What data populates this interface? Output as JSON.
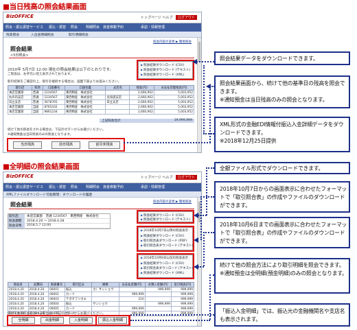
{
  "section1": {
    "title": "■当日残高の照会結果画面",
    "app": {
      "logo": "BizOFFICE",
      "toplinks": "トップページ  ヘルプ",
      "logout": "ログアウト",
      "nav": [
        "照会・振込振替サービス",
        "振込・振替",
        "照会",
        "明細照会",
        "資金移動予約",
        "承認・情報管理"
      ],
      "subnav": [
        "残高照会",
        "入出金明細照会",
        "取引明細照会"
      ],
      "page_title": "照会結果",
      "page_sub": "<5日照会>",
      "top_right_link": "照会内容の変更  ▶  簡易照会",
      "datetime": "2010年 5月7日 12:00 現在の照会結果は以下のとおりです。",
      "datetime_note": "ご照会は、お手元に控え表示されております。",
      "downloads": [
        "照会結果ダウンロード (CSV)",
        "照会結果ダウンロード (テキスト)",
        "照会結果ダウンロード (XML)"
      ],
      "table_caption": "取引結果をご確認の上、取引を継続する場合は、画面下部よりお進みください。",
      "table": {
        "headers": [
          "取引店",
          "科目",
          "口座番号",
          "口座名義",
          "支店名",
          "残高(円)",
          "お支払可能残高(円)"
        ],
        "rows": [
          [
            "本店営業部",
            "普通",
            "1234567",
            "東西物産　株式会社",
            "",
            "2,660,902",
            "5,003,952"
          ],
          [
            "丸の内支店",
            "普通",
            "1234567",
            "東西物産　株式会社",
            "北海道支店",
            "2,660,902",
            "5,003,952"
          ],
          [
            "日立支店",
            "普通",
            "5678765",
            "東西物産　株式会社",
            "日立支店",
            "2,660,902",
            "5,003,952"
          ],
          [
            "本店営業部",
            "当座",
            "8765432",
            "東西物産　株式会社",
            "",
            "2,660,902",
            "5,003,952"
          ],
          [
            "本店営業部",
            "当座",
            "9861234",
            "東西物産　株式会社",
            "",
            "2,660,902",
            "5,003,952"
          ]
        ]
      },
      "total_label": "上記照会合計",
      "total_value": "19,999,999",
      "footer_text": "続けて他の照会をされる場合は、下記のボタンからお選びください。",
      "footer_note": "※通知預金は当日残高のみの照会となります。",
      "buttons": [
        "当日残高",
        "前日残高",
        "前月末残高"
      ]
    },
    "notes": [
      "照会結果データをダウンロードできます。",
      "照会結果画面から、続けて他の基準日の残高を照会できます。\n※通知預金は当日残高のみの照会となります。",
      "XML形式の金融EDI情報付振込入金詳細データをダウンロードできます。\n※2018年12月25日提供"
    ]
  },
  "section2": {
    "title": "■全明細の照会結果画面",
    "app": {
      "logo": "BizOFFICE",
      "toplinks": "トップページ  ヘルプ",
      "logout": "ログアウト",
      "nav": [
        "照会・振込振替サービス",
        "振込・振替",
        "照会",
        "明細照会",
        "資金移動予約",
        "承認・情報管理"
      ],
      "breadcrumb": "XMLファイルダウンロード可能期間：ダウンロードの履歴",
      "page_title": "照会結果",
      "top_right_link": "照会内容の変更  ▶  簡易照会",
      "info": [
        [
          "取引店",
          "本店営業部　普通 1234567　東西物産　株式会社"
        ],
        [
          "照会期間",
          "2018.4.20 〜 2018.4.28"
        ],
        [
          "照会日時",
          "2018.5.7 12:00"
        ]
      ],
      "downloads_group1": [
        "照会結果ダウンロード (CSV)",
        "照会結果ダウンロード (テキスト)"
      ],
      "downloads_group1_head": "2018年10月7日以降の照会表示",
      "downloads_group2_head": "2018年10月6日以前の照会表示",
      "downloads_group2": [
        "照会結果ダウンロード (CSV)",
        "取引照合表ダウンロード (PDF)",
        "取引照合表ダウンロード (テキスト)"
      ],
      "downloads_group3": [
        "照会結果ダウンロード (CSV)",
        "取引照合表ダウンロード (テキスト)",
        "照会結果ダウンロード (XML)"
      ],
      "table": {
        "headers": [
          "照会日",
          "起算日",
          "取扱番号",
          "取引区分",
          "摘要",
          "お支払金額(円)",
          "お預入金額(円)",
          "差引残高(円)"
        ],
        "rows": [
          [
            "2018.4.20",
            "2018.4.20",
            "00001",
            "振込",
            "カ）サンショウ",
            "",
            "999,999",
            "999,999"
          ],
          [
            "2018.4.20",
            "2018.4.20",
            "00002",
            "カード",
            "",
            "999,999",
            "",
            "999,999"
          ],
          [
            "2018.4.20",
            "2018.4.20",
            "00003",
            "テガタフリカエ",
            "",
            "210",
            "",
            "999,999"
          ],
          [
            "2018.4.20",
            "2018.4.20",
            "00004",
            "振込",
            "サンショウ",
            "",
            "999,999",
            "999,999"
          ],
          [
            "2018.4.20",
            "2018.4.20",
            "00005",
            "カード",
            "",
            "999,999",
            "",
            "999,999"
          ],
          [
            "2018.4.20",
            "2018.4.20",
            "00006",
            "カード",
            "",
            "999,999",
            "",
            "999,999"
          ]
        ]
      },
      "footer_text": "続けて他の照会をされる場合は、下記のボタンからお選びください。",
      "buttons": [
        "全明細",
        "出金明細",
        "入金明細",
        "振込入金明細"
      ]
    },
    "notes": [
      "全銀ファイル形式でダウンロードできます。",
      "2018年10月7日からの画面表示に合わせたフォーマットで「取引照合表」の作成やファイルのダウンロードができます。",
      "2018年10月6日までの画面表示に合わせたフォーマットで「取引照合表」の作成やファイルのダウンロードができます。",
      "続けて他の照会方法により取引明細を照会できます。\n※通知預金は全明細(預金明細)のみの照会となります。",
      "「振込入金明細」では、振込元の金融機関名や支店名も表示されます。"
    ]
  }
}
